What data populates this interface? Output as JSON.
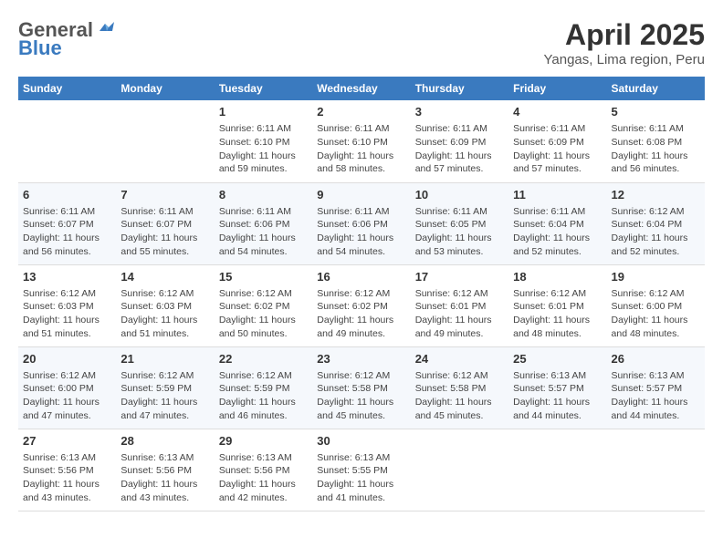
{
  "logo": {
    "general": "General",
    "blue": "Blue"
  },
  "title": "April 2025",
  "subtitle": "Yangas, Lima region, Peru",
  "days_header": [
    "Sunday",
    "Monday",
    "Tuesday",
    "Wednesday",
    "Thursday",
    "Friday",
    "Saturday"
  ],
  "weeks": [
    [
      {
        "day": "",
        "info": ""
      },
      {
        "day": "",
        "info": ""
      },
      {
        "day": "1",
        "info": "Sunrise: 6:11 AM\nSunset: 6:10 PM\nDaylight: 11 hours and 59 minutes."
      },
      {
        "day": "2",
        "info": "Sunrise: 6:11 AM\nSunset: 6:10 PM\nDaylight: 11 hours and 58 minutes."
      },
      {
        "day": "3",
        "info": "Sunrise: 6:11 AM\nSunset: 6:09 PM\nDaylight: 11 hours and 57 minutes."
      },
      {
        "day": "4",
        "info": "Sunrise: 6:11 AM\nSunset: 6:09 PM\nDaylight: 11 hours and 57 minutes."
      },
      {
        "day": "5",
        "info": "Sunrise: 6:11 AM\nSunset: 6:08 PM\nDaylight: 11 hours and 56 minutes."
      }
    ],
    [
      {
        "day": "6",
        "info": "Sunrise: 6:11 AM\nSunset: 6:07 PM\nDaylight: 11 hours and 56 minutes."
      },
      {
        "day": "7",
        "info": "Sunrise: 6:11 AM\nSunset: 6:07 PM\nDaylight: 11 hours and 55 minutes."
      },
      {
        "day": "8",
        "info": "Sunrise: 6:11 AM\nSunset: 6:06 PM\nDaylight: 11 hours and 54 minutes."
      },
      {
        "day": "9",
        "info": "Sunrise: 6:11 AM\nSunset: 6:06 PM\nDaylight: 11 hours and 54 minutes."
      },
      {
        "day": "10",
        "info": "Sunrise: 6:11 AM\nSunset: 6:05 PM\nDaylight: 11 hours and 53 minutes."
      },
      {
        "day": "11",
        "info": "Sunrise: 6:11 AM\nSunset: 6:04 PM\nDaylight: 11 hours and 52 minutes."
      },
      {
        "day": "12",
        "info": "Sunrise: 6:12 AM\nSunset: 6:04 PM\nDaylight: 11 hours and 52 minutes."
      }
    ],
    [
      {
        "day": "13",
        "info": "Sunrise: 6:12 AM\nSunset: 6:03 PM\nDaylight: 11 hours and 51 minutes."
      },
      {
        "day": "14",
        "info": "Sunrise: 6:12 AM\nSunset: 6:03 PM\nDaylight: 11 hours and 51 minutes."
      },
      {
        "day": "15",
        "info": "Sunrise: 6:12 AM\nSunset: 6:02 PM\nDaylight: 11 hours and 50 minutes."
      },
      {
        "day": "16",
        "info": "Sunrise: 6:12 AM\nSunset: 6:02 PM\nDaylight: 11 hours and 49 minutes."
      },
      {
        "day": "17",
        "info": "Sunrise: 6:12 AM\nSunset: 6:01 PM\nDaylight: 11 hours and 49 minutes."
      },
      {
        "day": "18",
        "info": "Sunrise: 6:12 AM\nSunset: 6:01 PM\nDaylight: 11 hours and 48 minutes."
      },
      {
        "day": "19",
        "info": "Sunrise: 6:12 AM\nSunset: 6:00 PM\nDaylight: 11 hours and 48 minutes."
      }
    ],
    [
      {
        "day": "20",
        "info": "Sunrise: 6:12 AM\nSunset: 6:00 PM\nDaylight: 11 hours and 47 minutes."
      },
      {
        "day": "21",
        "info": "Sunrise: 6:12 AM\nSunset: 5:59 PM\nDaylight: 11 hours and 47 minutes."
      },
      {
        "day": "22",
        "info": "Sunrise: 6:12 AM\nSunset: 5:59 PM\nDaylight: 11 hours and 46 minutes."
      },
      {
        "day": "23",
        "info": "Sunrise: 6:12 AM\nSunset: 5:58 PM\nDaylight: 11 hours and 45 minutes."
      },
      {
        "day": "24",
        "info": "Sunrise: 6:12 AM\nSunset: 5:58 PM\nDaylight: 11 hours and 45 minutes."
      },
      {
        "day": "25",
        "info": "Sunrise: 6:13 AM\nSunset: 5:57 PM\nDaylight: 11 hours and 44 minutes."
      },
      {
        "day": "26",
        "info": "Sunrise: 6:13 AM\nSunset: 5:57 PM\nDaylight: 11 hours and 44 minutes."
      }
    ],
    [
      {
        "day": "27",
        "info": "Sunrise: 6:13 AM\nSunset: 5:56 PM\nDaylight: 11 hours and 43 minutes."
      },
      {
        "day": "28",
        "info": "Sunrise: 6:13 AM\nSunset: 5:56 PM\nDaylight: 11 hours and 43 minutes."
      },
      {
        "day": "29",
        "info": "Sunrise: 6:13 AM\nSunset: 5:56 PM\nDaylight: 11 hours and 42 minutes."
      },
      {
        "day": "30",
        "info": "Sunrise: 6:13 AM\nSunset: 5:55 PM\nDaylight: 11 hours and 41 minutes."
      },
      {
        "day": "",
        "info": ""
      },
      {
        "day": "",
        "info": ""
      },
      {
        "day": "",
        "info": ""
      }
    ]
  ]
}
